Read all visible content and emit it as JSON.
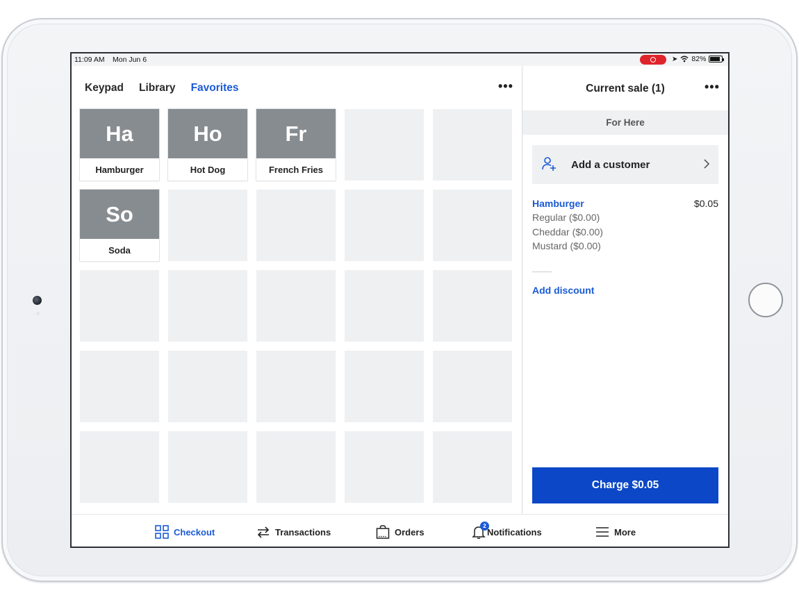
{
  "statusbar": {
    "time": "11:09 AM",
    "date": "Mon Jun 6",
    "battery": "82%",
    "battery_level": 0.82
  },
  "tabs": [
    {
      "label": "Keypad",
      "active": false
    },
    {
      "label": "Library",
      "active": false
    },
    {
      "label": "Favorites",
      "active": true
    }
  ],
  "favorites": [
    {
      "abbr": "Ha",
      "name": "Hamburger"
    },
    {
      "abbr": "Ho",
      "name": "Hot Dog"
    },
    {
      "abbr": "Fr",
      "name": "French Fries"
    },
    {
      "abbr": "So",
      "name": "Soda"
    }
  ],
  "cart": {
    "title": "Current sale (1)",
    "dining_option": "For Here",
    "add_customer": "Add a customer",
    "items": [
      {
        "name": "Hamburger",
        "price": "$0.05",
        "modifiers": [
          "Regular ($0.00)",
          "Cheddar ($0.00)",
          "Mustard ($0.00)"
        ]
      }
    ],
    "add_discount": "Add discount",
    "charge": "Charge $0.05"
  },
  "nav": {
    "checkout": "Checkout",
    "transactions": "Transactions",
    "orders": "Orders",
    "notifications": "Notifications",
    "notifications_badge": "2",
    "more": "More"
  },
  "colors": {
    "accent": "#1a5ad6",
    "charge_button": "#0b47c6",
    "tile_header": "#878c90",
    "record": "#e0242b"
  }
}
